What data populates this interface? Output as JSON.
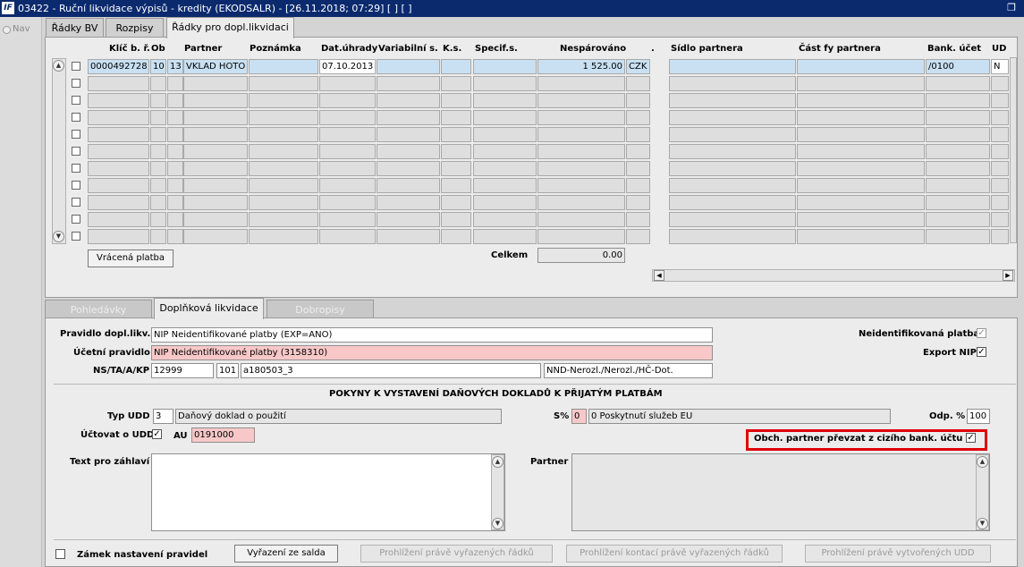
{
  "window": {
    "title": "03422 - Ruční likvidace výpisů - kredity (EKODSALR) - [26.11.2018; 07:29] [ ] [ ]",
    "app_icon_text": "IF"
  },
  "nav": {
    "label": "Nav"
  },
  "top_tabs": [
    {
      "label": "Řádky BV"
    },
    {
      "label": "Rozpisy"
    },
    {
      "label": "Řádky pro dopl.likvidaci"
    }
  ],
  "grid": {
    "headers": [
      "Klíč b. ř.",
      "Ob",
      "Partner",
      "Poznámka",
      "Dat.úhrady",
      "Variabilní s.",
      "K.s.",
      "Specif.s.",
      "Nespárováno",
      ".",
      "Sídlo partnera",
      "Část fy partnera",
      "Bank. účet",
      "UD"
    ],
    "row1": {
      "klic": "0000492728",
      "ob1": "10",
      "ob2": "13",
      "partner": "VKLAD HOTO",
      "poznamka": "",
      "datum": "07.10.2013",
      "vs": "",
      "ks": "",
      "ss": "",
      "nesparovano": "1 525.00",
      "mena": "CZK",
      "sidlo": "",
      "cast": "",
      "ucet": "/0100",
      "ud": "N"
    },
    "return_button": "Vrácená platba",
    "total_label": "Celkem",
    "total_value": "0.00"
  },
  "bottom_tabs": [
    {
      "label": "Pohledávky"
    },
    {
      "label": "Doplňková likvidace"
    },
    {
      "label": "Dobropisy"
    }
  ],
  "form": {
    "pravidlo_label": "Pravidlo dopl.likv.",
    "pravidlo_value": "NIP Neidentifikované platby (EXP=ANO)",
    "ucetni_label": "Účetní pravidlo",
    "ucetni_value": "NIP Neidentifikované platby (3158310)",
    "ns_label": "NS/TA/A/KP",
    "ns_value": "12999",
    "ta_value": "101",
    "a_value": "a180503_3",
    "kp_value": "NND-Nerozl./Nerozl./HČ-Dot.",
    "neident_label": "Neidentifikovaná platba",
    "export_label": "Export NIP",
    "section_title": "POKYNY K VYSTAVENÍ DAŇOVÝCH DOKLADŮ K PŘIJATÝM PLATBÁM",
    "typ_label": "Typ UDD",
    "typ_code": "3",
    "typ_value": "Daňový doklad o použití",
    "s_label": "S%",
    "s_code": "0",
    "s_value": "0 Poskytnutí služeb EU",
    "odp_label": "Odp. %",
    "odp_value": "100",
    "uctovat_label": "Účtovat o UDD",
    "au_label": "AU",
    "au_value": "0191000",
    "obch_label": "Obch. partner převzat z cizího bank. účtu",
    "text_label": "Text pro záhlaví",
    "partner_label": "Partner",
    "zamek_label": "Zámek nastavení pravidel"
  },
  "buttons": {
    "vyrazeni": "Vyřazení ze salda",
    "prohl1": "Prohlížení právě vyřazených řádků",
    "prohl2": "Prohlížení kontací právě vyřazených řádků",
    "prohl3": "Prohlížení právě vytvořených UDD"
  },
  "check_glyph": "✓",
  "colors": {
    "highlight": "#e00000",
    "title_bg": "#0b2a6e",
    "selected_row": "#c8e0f2",
    "pink_field": "#f8c8c8"
  }
}
